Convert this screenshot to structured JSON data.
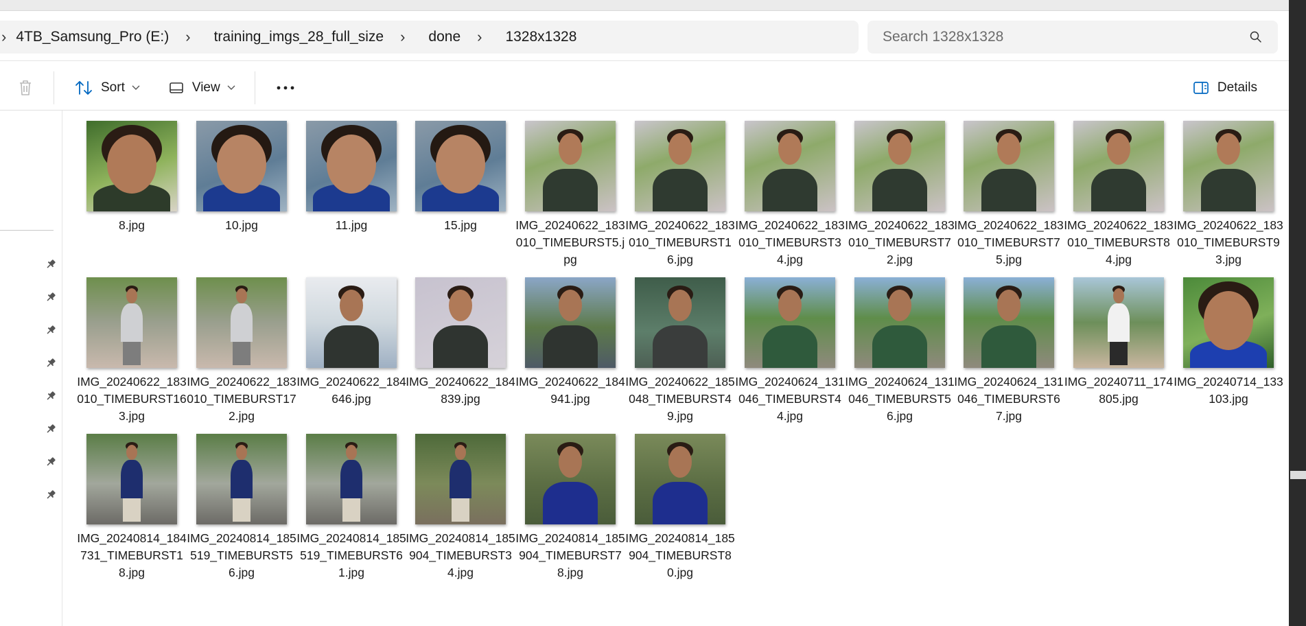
{
  "address_bar": {
    "crumbs": [
      "4TB_Samsung_Pro (E:)",
      "training_imgs_28_full_size",
      "done",
      "1328x1328"
    ]
  },
  "search": {
    "placeholder": "Search 1328x1328"
  },
  "toolbar": {
    "sort_label": "Sort",
    "view_label": "View",
    "details_label": "Details"
  },
  "colors": {
    "accent": "#0067c0",
    "background": "#ffffff",
    "chrome": "#f3f3f3",
    "scrollbar": "#2b2b2b"
  },
  "files": [
    {
      "name": "8.jpg",
      "scene": "closeup-selfie"
    },
    {
      "name": "10.jpg",
      "scene": "closeup-blue"
    },
    {
      "name": "11.jpg",
      "scene": "closeup-blue"
    },
    {
      "name": "15.jpg",
      "scene": "closeup-blue"
    },
    {
      "name": "IMG_20240622_183010_TIMEBURST5.jpg",
      "scene": "tanktop"
    },
    {
      "name": "IMG_20240622_183010_TIMEBURST16.jpg",
      "scene": "tanktop"
    },
    {
      "name": "IMG_20240622_183010_TIMEBURST34.jpg",
      "scene": "tanktop"
    },
    {
      "name": "IMG_20240622_183010_TIMEBURST72.jpg",
      "scene": "tanktop"
    },
    {
      "name": "IMG_20240622_183010_TIMEBURST75.jpg",
      "scene": "tanktop"
    },
    {
      "name": "IMG_20240622_183010_TIMEBURST84.jpg",
      "scene": "tanktop"
    },
    {
      "name": "IMG_20240622_183010_TIMEBURST93.jpg",
      "scene": "tanktop"
    },
    {
      "name": "IMG_20240622_183010_TIMEBURST163.jpg",
      "scene": "fullbody-tank"
    },
    {
      "name": "IMG_20240622_183010_TIMEBURST172.jpg",
      "scene": "fullbody-tank"
    },
    {
      "name": "IMG_20240622_184646.jpg",
      "scene": "tank-porch"
    },
    {
      "name": "IMG_20240622_184839.jpg",
      "scene": "tank-wall"
    },
    {
      "name": "IMG_20240622_184941.jpg",
      "scene": "tank-street"
    },
    {
      "name": "IMG_20240622_185048_TIMEBURST49.jpg",
      "scene": "tank-tree"
    },
    {
      "name": "IMG_20240624_131046_TIMEBURST44.jpg",
      "scene": "green-shirt"
    },
    {
      "name": "IMG_20240624_131046_TIMEBURST56.jpg",
      "scene": "green-shirt"
    },
    {
      "name": "IMG_20240624_131046_TIMEBURST67.jpg",
      "scene": "green-shirt"
    },
    {
      "name": "IMG_20240711_174805.jpg",
      "scene": "white-shirt"
    },
    {
      "name": "IMG_20240714_133103.jpg",
      "scene": "blue-closeup"
    },
    {
      "name": "IMG_20240814_184731_TIMEBURST18.jpg",
      "scene": "polo-full"
    },
    {
      "name": "IMG_20240814_185519_TIMEBURST56.jpg",
      "scene": "polo-full"
    },
    {
      "name": "IMG_20240814_185519_TIMEBURST61.jpg",
      "scene": "polo-full"
    },
    {
      "name": "IMG_20240814_185904_TIMEBURST34.jpg",
      "scene": "polo-shorts"
    },
    {
      "name": "IMG_20240814_185904_TIMEBURST78.jpg",
      "scene": "polo-half"
    },
    {
      "name": "IMG_20240814_185904_TIMEBURST80.jpg",
      "scene": "polo-half"
    }
  ],
  "icons": [
    "chevron-right-icon",
    "search-icon",
    "delete-icon",
    "sort-icon",
    "view-icon",
    "chevron-down-icon",
    "more-icon",
    "details-pane-icon",
    "pin-icon"
  ]
}
